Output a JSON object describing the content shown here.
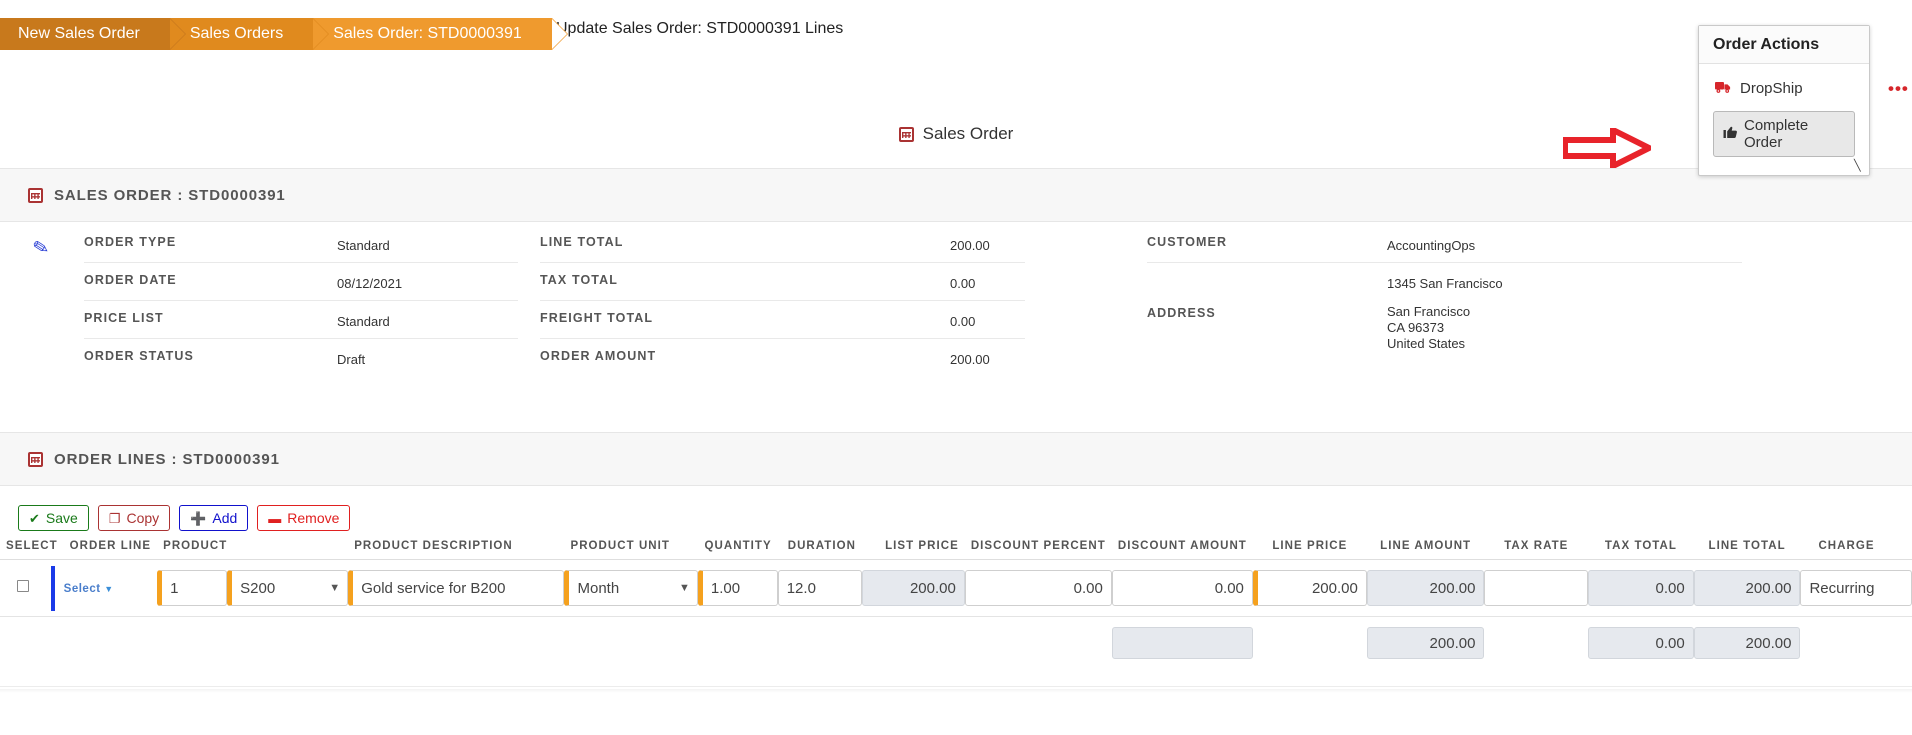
{
  "breadcrumb": [
    {
      "label": "New Sales Order"
    },
    {
      "label": "Sales Orders"
    },
    {
      "label": "Sales Order: STD0000391"
    }
  ],
  "page_title": "Update Sales Order: STD0000391 Lines",
  "center_label": "Sales Order",
  "order_actions": {
    "title": "Order Actions",
    "dropship_label": "DropShip",
    "complete_order_label": "Complete Order",
    "truck_icon": "truck-icon",
    "thumbsup_icon": "thumbs-up-icon",
    "accent_color": "#d6262b"
  },
  "overflow_menu": {
    "label": "•••",
    "icon": "ellipsis-icon"
  },
  "sections": {
    "sales_order": {
      "title": "SALES ORDER : STD0000391",
      "icon": "grid-icon"
    },
    "order_lines": {
      "title": "ORDER LINES : STD0000391",
      "icon": "grid-icon"
    }
  },
  "detail": {
    "edit_icon": "pencil-icon",
    "left": [
      {
        "label": "ORDER TYPE",
        "value": "Standard"
      },
      {
        "label": "ORDER DATE",
        "value": "08/12/2021"
      },
      {
        "label": "PRICE LIST",
        "value": "Standard"
      },
      {
        "label": "ORDER STATUS",
        "value": "Draft"
      }
    ],
    "middle": [
      {
        "label": "LINE TOTAL",
        "value": "200.00"
      },
      {
        "label": "TAX TOTAL",
        "value": "0.00"
      },
      {
        "label": "FREIGHT TOTAL",
        "value": "0.00"
      },
      {
        "label": "ORDER AMOUNT",
        "value": "200.00"
      }
    ],
    "right": {
      "customer_label": "CUSTOMER",
      "customer_value": "AccountingOps",
      "address_label": "ADDRESS",
      "address_top": "1345 San Francisco",
      "address_line1": "San Francisco",
      "address_line2": "CA 96373",
      "address_line3": "United States"
    }
  },
  "toolbar": {
    "save_label": "Save",
    "copy_label": "Copy",
    "add_label": "Add",
    "remove_label": "Remove",
    "save_icon": "check-icon",
    "copy_icon": "copy-icon",
    "add_icon": "plus-icon",
    "remove_icon": "minus-icon"
  },
  "grid": {
    "headers": {
      "select": "SELECT",
      "order_line": "ORDER LINE",
      "product": "PRODUCT",
      "product_description": "PRODUCT DESCRIPTION",
      "product_unit": "PRODUCT UNIT",
      "quantity": "QUANTITY",
      "duration": "DURATION",
      "list_price": "LIST PRICE",
      "discount_percent": "DISCOUNT PERCENT",
      "discount_amount": "DISCOUNT AMOUNT",
      "line_price": "LINE PRICE",
      "line_amount": "LINE AMOUNT",
      "tax_rate": "TAX RATE",
      "tax_total": "TAX TOTAL",
      "line_total": "LINE TOTAL",
      "charge": "CHARGE"
    },
    "row": {
      "select_label": "Select",
      "order_line": "1",
      "product": "S200",
      "product_description": "Gold service for B200",
      "product_unit": "Month",
      "quantity": "1.00",
      "duration": "12.0",
      "list_price": "200.00",
      "discount_percent": "0.00",
      "discount_amount": "0.00",
      "line_price": "200.00",
      "line_amount": "200.00",
      "tax_rate": "",
      "tax_total": "0.00",
      "line_total": "200.00",
      "charge": "Recurring"
    },
    "summary": {
      "discount_amount": "",
      "line_price": "200.00",
      "tax_total": "0.00",
      "line_total": "200.00"
    }
  },
  "annotation": {
    "arrow_icon": "right-arrow-annotation",
    "color": "#e8232a"
  }
}
